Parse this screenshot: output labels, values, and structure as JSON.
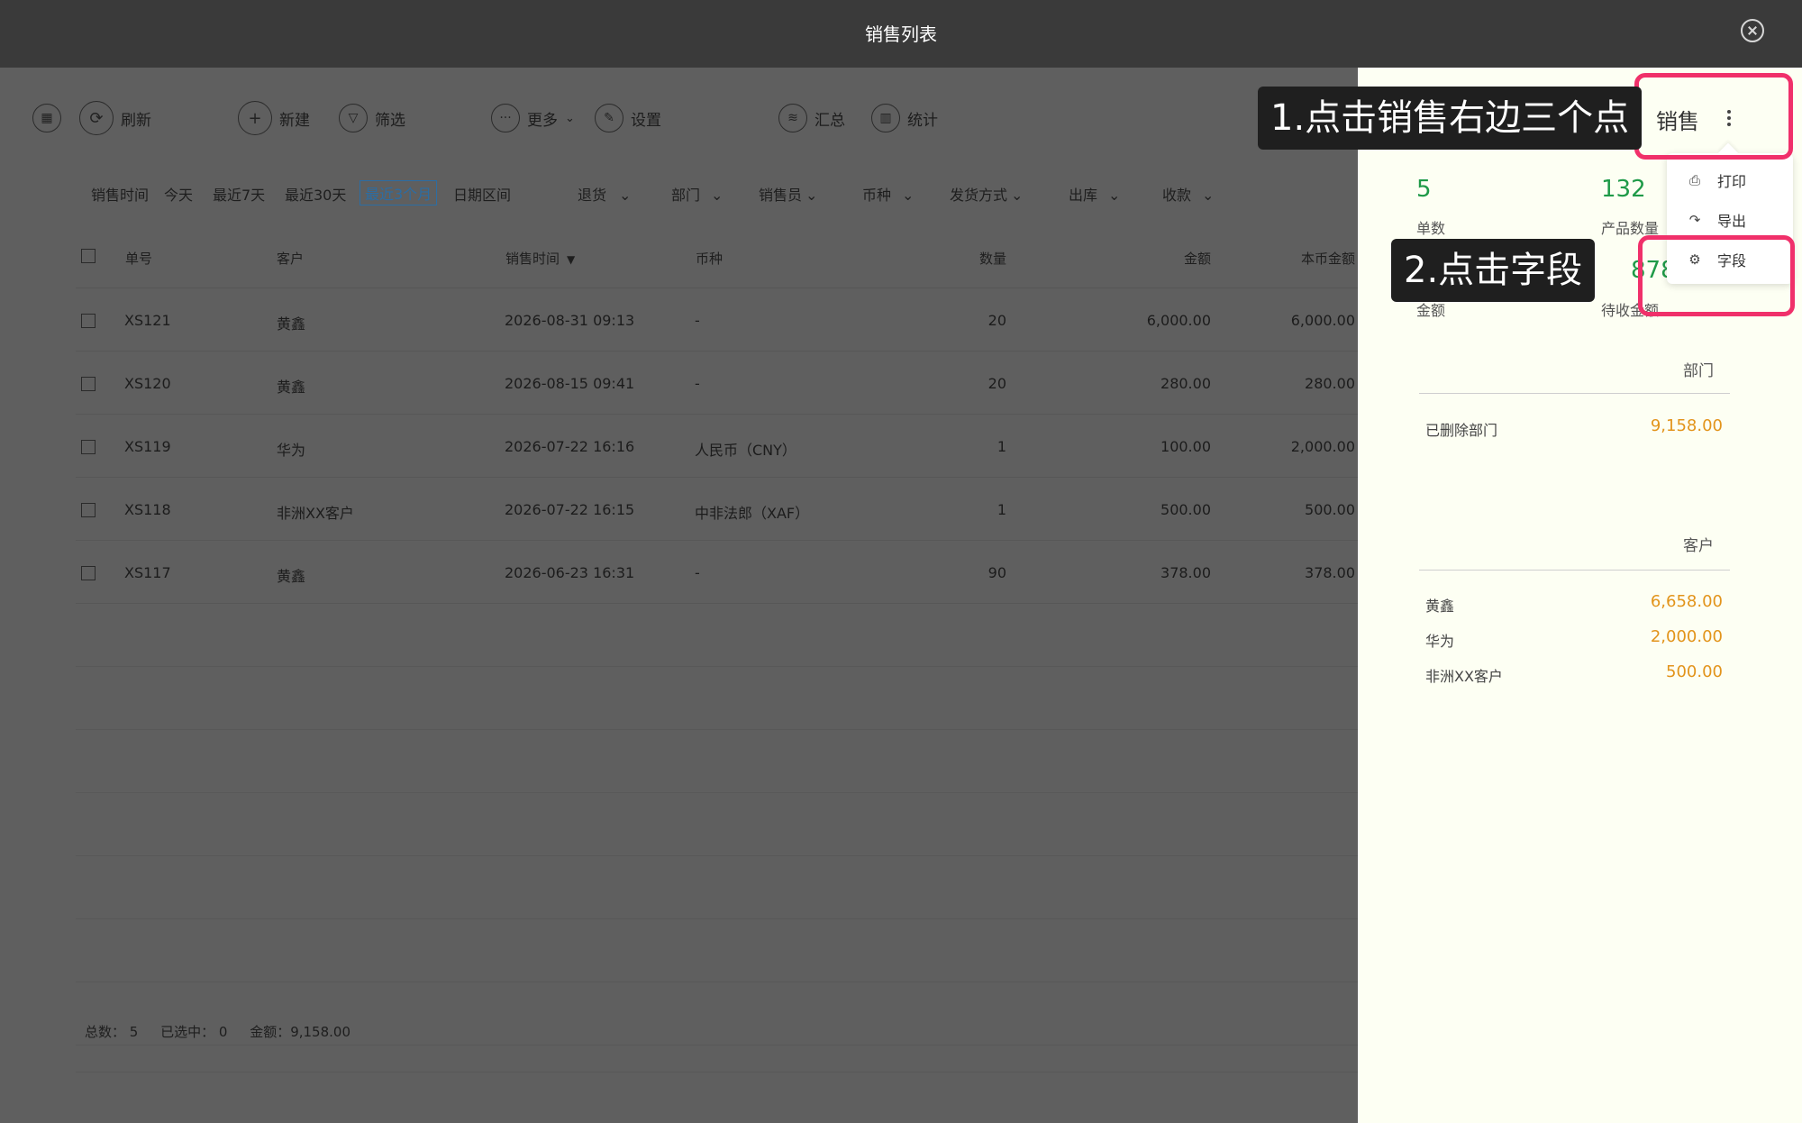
{
  "window": {
    "title": "销售列表"
  },
  "toolbar": {
    "refresh": "刷新",
    "new": "新建",
    "filter": "筛选",
    "more": "更多",
    "settings": "设置",
    "summary": "汇总",
    "stats": "统计"
  },
  "filters": {
    "sales_time": "销售时间",
    "today": "今天",
    "last7": "最近7天",
    "last30": "最近30天",
    "last3m": "最近3个月",
    "date_range": "日期区间",
    "returns": "退货",
    "department": "部门",
    "salesperson": "销售员",
    "currency": "币种",
    "shipping": "发货方式",
    "outbound": "出库",
    "payment": "收款"
  },
  "table": {
    "headers": {
      "order_no": "单号",
      "customer": "客户",
      "sales_time": "销售时间",
      "currency": "币种",
      "quantity": "数量",
      "amount": "金额",
      "base_amount": "本币金额"
    },
    "rows": [
      {
        "order_no": "XS121",
        "customer": "黄鑫",
        "sales_time": "2026-08-31 09:13",
        "currency": "-",
        "quantity": "20",
        "amount": "6,000.00",
        "base_amount": "6,000.00"
      },
      {
        "order_no": "XS120",
        "customer": "黄鑫",
        "sales_time": "2026-08-15 09:41",
        "currency": "-",
        "quantity": "20",
        "amount": "280.00",
        "base_amount": "280.00"
      },
      {
        "order_no": "XS119",
        "customer": "华为",
        "sales_time": "2026-07-22 16:16",
        "currency": "人民币（CNY）",
        "quantity": "1",
        "amount": "100.00",
        "base_amount": "2,000.00"
      },
      {
        "order_no": "XS118",
        "customer": "非洲XX客户",
        "sales_time": "2026-07-22 16:15",
        "currency": "中非法郎（XAF）",
        "quantity": "1",
        "amount": "500.00",
        "base_amount": "500.00"
      },
      {
        "order_no": "XS117",
        "customer": "黄鑫",
        "sales_time": "2026-06-23 16:31",
        "currency": "-",
        "quantity": "90",
        "amount": "378.00",
        "base_amount": "378.00"
      }
    ]
  },
  "footer": {
    "total": "总数：  5",
    "selected": "已选中：  0",
    "amount": "金额：9,158.00"
  },
  "panel": {
    "title": "销售",
    "stats": {
      "orders_value": "5",
      "orders_label": "单数",
      "products_value": "132",
      "products_label": "产品数量",
      "receivable_value": "878.0",
      "amount_label": "金额",
      "receivable_label": "待收金额"
    },
    "department": {
      "heading": "部门",
      "items": [
        {
          "name": "已删除部门",
          "value": "9,158.00"
        }
      ]
    },
    "customer": {
      "heading": "客户",
      "items": [
        {
          "name": "黄鑫",
          "value": "6,658.00"
        },
        {
          "name": "华为",
          "value": "2,000.00"
        },
        {
          "name": "非洲XX客户",
          "value": "500.00"
        }
      ]
    },
    "menu": {
      "print": "打印",
      "export": "导出",
      "fields": "字段"
    }
  },
  "annotations": {
    "step1": "1.点击销售右边三个点",
    "step2": "2.点击字段"
  },
  "colors": {
    "highlight": "#f0306a",
    "green": "#1f9a48",
    "orange": "#e2941b",
    "active_filter": "#2c6da3"
  }
}
